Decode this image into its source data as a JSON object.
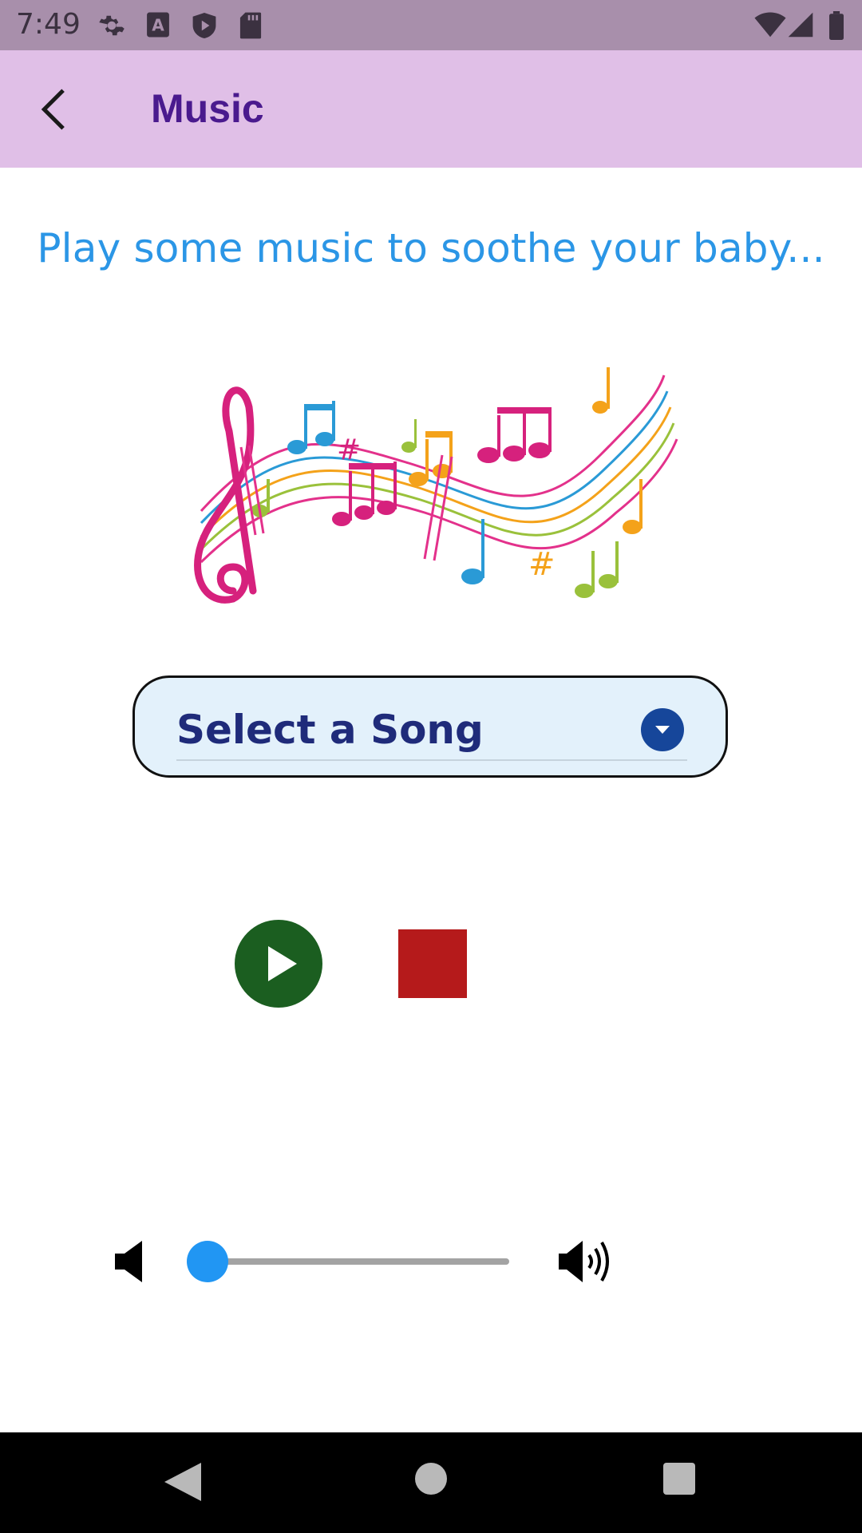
{
  "status_bar": {
    "time": "7:49",
    "icons": [
      "gear-icon",
      "font-a-icon",
      "shield-play-icon",
      "sd-card-icon",
      "wifi-icon",
      "signal-icon",
      "battery-icon"
    ]
  },
  "app_bar": {
    "title": "Music",
    "back_icon": "chevron-left-icon"
  },
  "main": {
    "subtitle": "Play some music to soothe your baby...",
    "image": "music-notes-illustration",
    "song_select": {
      "placeholder": "Select a Song",
      "icon": "dropdown-circle-icon"
    },
    "controls": {
      "play_icon": "play-icon",
      "stop_icon": "stop-icon"
    },
    "volume": {
      "level": 0.0,
      "low_icon": "volume-low-icon",
      "high_icon": "volume-high-icon"
    }
  },
  "colors": {
    "status_bar": "#a88fab",
    "app_bar": "#e0bfe7",
    "title": "#4a1a8e",
    "subtitle": "#2b96e6",
    "select_bg": "#e3f1fb",
    "select_text": "#1f2b7a",
    "play": "#1b5e20",
    "stop": "#b51a1b",
    "slider": "#2196f3"
  },
  "nav_bar": {
    "icons": [
      "nav-back-icon",
      "nav-home-icon",
      "nav-recents-icon"
    ]
  }
}
